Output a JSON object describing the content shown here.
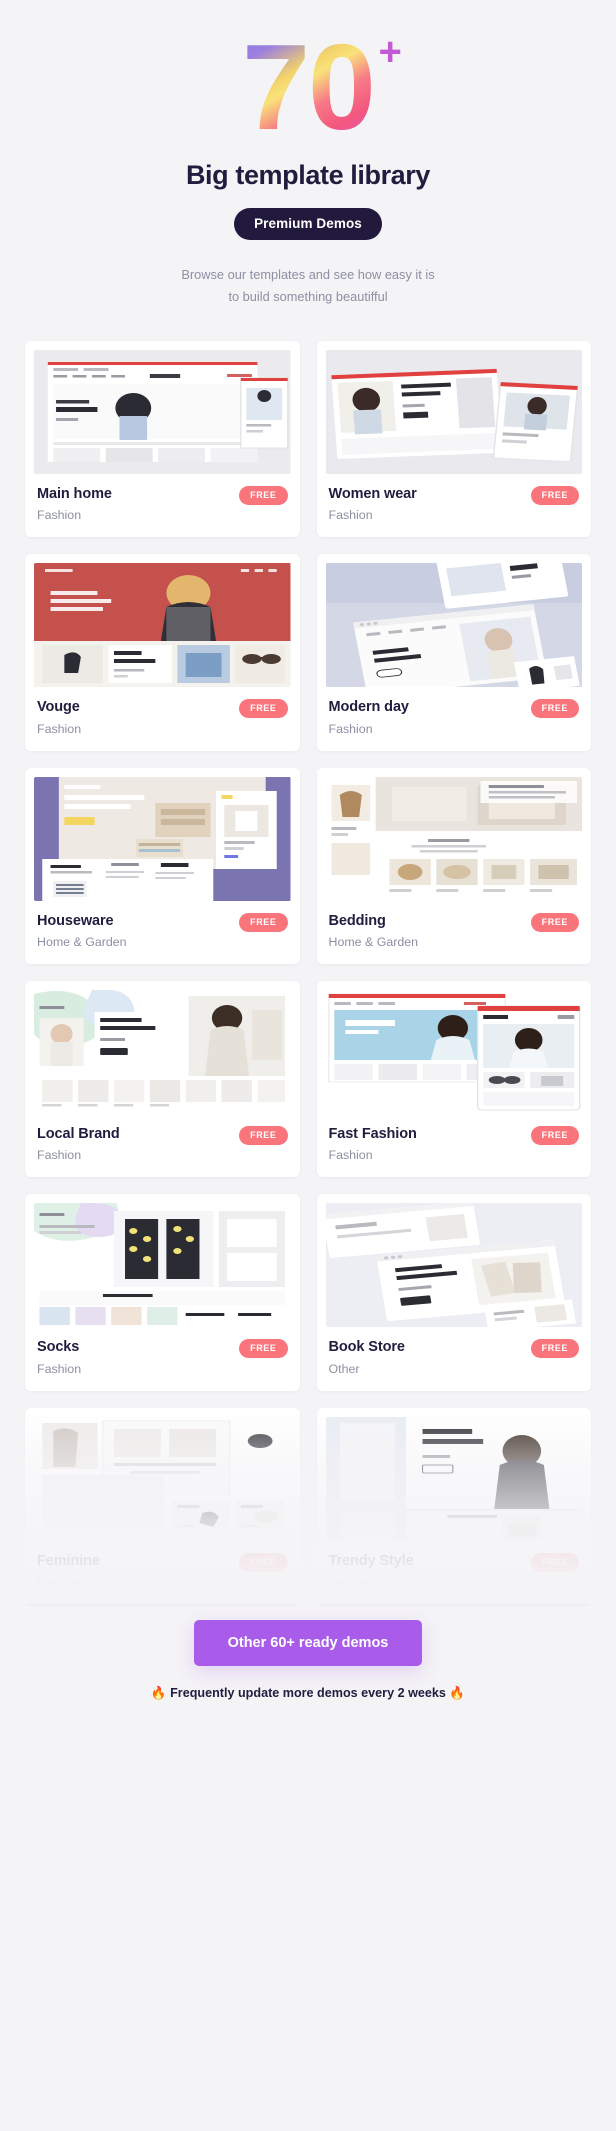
{
  "hero": {
    "count": "70",
    "plus": "+",
    "title": "Big template library",
    "badge": "Premium Demos",
    "subtitle_line1": "Browse our templates and see how easy it is",
    "subtitle_line2": "to build something beautifful"
  },
  "free_label": "FREE",
  "cards": [
    {
      "title": "Main home",
      "category": "Fashion",
      "free": "FREE",
      "theme": "main-home"
    },
    {
      "title": "Women wear",
      "category": "Fashion",
      "free": "FREE",
      "theme": "women-wear"
    },
    {
      "title": "Vouge",
      "category": "Fashion",
      "free": "FREE",
      "theme": "vouge"
    },
    {
      "title": "Modern day",
      "category": "Fashion",
      "free": "FREE",
      "theme": "modern-day"
    },
    {
      "title": "Houseware",
      "category": "Home & Garden",
      "free": "FREE",
      "theme": "houseware"
    },
    {
      "title": "Bedding",
      "category": "Home & Garden",
      "free": "FREE",
      "theme": "bedding"
    },
    {
      "title": "Local Brand",
      "category": "Fashion",
      "free": "FREE",
      "theme": "local-brand"
    },
    {
      "title": "Fast Fashion",
      "category": "Fashion",
      "free": "FREE",
      "theme": "fast-fashion"
    },
    {
      "title": "Socks",
      "category": "Fashion",
      "free": "FREE",
      "theme": "socks"
    },
    {
      "title": "Book Store",
      "category": "Other",
      "free": "FREE",
      "theme": "book-store"
    },
    {
      "title": "Feminine",
      "category": "Fashion",
      "free": "FREE",
      "theme": "feminine"
    },
    {
      "title": "Trendy Style",
      "category": "Fashion",
      "free": "FREE",
      "theme": "trendy-style"
    }
  ],
  "footer": {
    "cta": "Other 60+ ready demos",
    "note_flame_left": "🔥",
    "note": "Frequently update more demos every 2 weeks",
    "note_flame_right": "🔥"
  },
  "colors": {
    "background": "#f4f3f6",
    "card": "#ffffff",
    "ink": "#231c3f",
    "muted": "#8d8fa3",
    "free_badge": "#f9757b",
    "cta_purple": "#a95cea",
    "gradient_start": "#8a7de0",
    "gradient_mid": "#f9e27a",
    "gradient_end": "#f2577e"
  }
}
